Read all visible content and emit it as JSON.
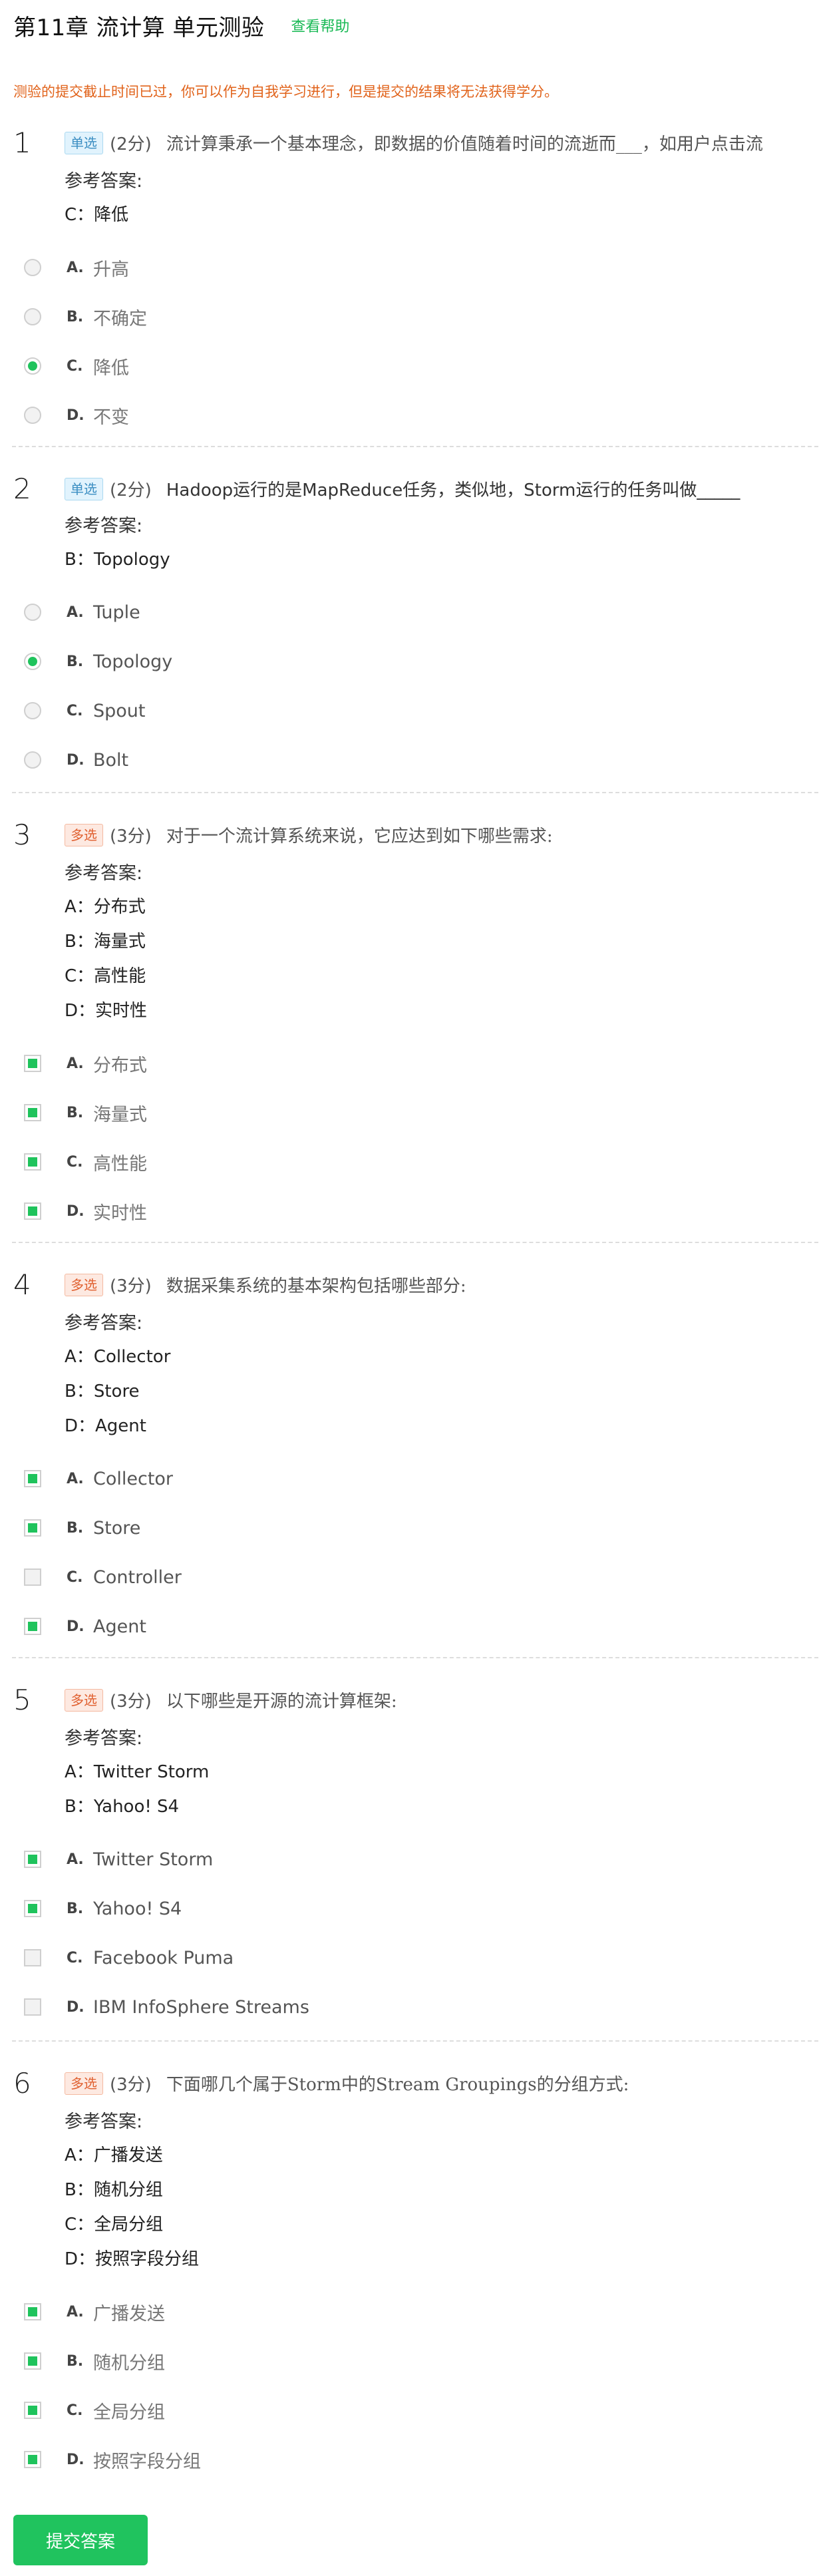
{
  "header": {
    "title": "第11章 流计算 单元测验",
    "help_link": "查看帮助"
  },
  "notice": "测验的提交截止时间已过，你可以作为自我学习进行，但是提交的结果将无法获得学分。",
  "ref_label": "参考答案:",
  "questions": [
    {
      "num": "1",
      "type": "单选",
      "score": "(2分)",
      "text": "流计算秉承一个基本理念，即数据的价值随着时间的流逝而___，如用户点击流",
      "answers": [
        "C：降低"
      ],
      "options": [
        {
          "letter": "A.",
          "text": "升高",
          "checked": false
        },
        {
          "letter": "B.",
          "text": "不确定",
          "checked": false
        },
        {
          "letter": "C.",
          "text": "降低",
          "checked": true
        },
        {
          "letter": "D.",
          "text": "不变",
          "checked": false
        }
      ]
    },
    {
      "num": "2",
      "type": "单选",
      "score": "(2分)",
      "text": "Hadoop运行的是MapReduce任务，类似地，Storm运行的任务叫做_____",
      "answers": [
        "B：Topology"
      ],
      "options": [
        {
          "letter": "A.",
          "text": "Tuple",
          "checked": false
        },
        {
          "letter": "B.",
          "text": "Topology",
          "checked": true
        },
        {
          "letter": "C.",
          "text": "Spout",
          "checked": false
        },
        {
          "letter": "D.",
          "text": "Bolt",
          "checked": false
        }
      ]
    },
    {
      "num": "3",
      "type": "多选",
      "score": "(3分)",
      "text": "对于一个流计算系统来说，它应达到如下哪些需求:",
      "answers": [
        "A：分布式",
        "B：海量式",
        "C：高性能",
        "D：实时性"
      ],
      "options": [
        {
          "letter": "A.",
          "text": "分布式",
          "checked": true
        },
        {
          "letter": "B.",
          "text": "海量式",
          "checked": true
        },
        {
          "letter": "C.",
          "text": "高性能",
          "checked": true
        },
        {
          "letter": "D.",
          "text": "实时性",
          "checked": true
        }
      ]
    },
    {
      "num": "4",
      "type": "多选",
      "score": "(3分)",
      "text": "数据采集系统的基本架构包括哪些部分:",
      "answers": [
        "A：Collector",
        "B：Store",
        "D：Agent"
      ],
      "options": [
        {
          "letter": "A.",
          "text": "Collector",
          "checked": true
        },
        {
          "letter": "B.",
          "text": "Store",
          "checked": true
        },
        {
          "letter": "C.",
          "text": "Controller",
          "checked": false
        },
        {
          "letter": "D.",
          "text": "Agent",
          "checked": true
        }
      ]
    },
    {
      "num": "5",
      "type": "多选",
      "score": "(3分)",
      "text": "以下哪些是开源的流计算框架:",
      "answers": [
        "A：Twitter Storm",
        "B：Yahoo! S4"
      ],
      "options": [
        {
          "letter": "A.",
          "text": "Twitter Storm",
          "checked": true
        },
        {
          "letter": "B.",
          "text": "Yahoo! S4",
          "checked": true
        },
        {
          "letter": "C.",
          "text": "Facebook Puma",
          "checked": false
        },
        {
          "letter": "D.",
          "text": "IBM InfoSphere Streams",
          "checked": false
        }
      ]
    },
    {
      "num": "6",
      "type": "多选",
      "score": "(3分)",
      "text": "下面哪几个属于Storm中的Stream Groupings的分组方式:",
      "answers": [
        "A：广播发送",
        "B：随机分组",
        "C：全局分组",
        "D：按照字段分组"
      ],
      "options": [
        {
          "letter": "A.",
          "text": "广播发送",
          "checked": true
        },
        {
          "letter": "B.",
          "text": "随机分组",
          "checked": true
        },
        {
          "letter": "C.",
          "text": "全局分组",
          "checked": true
        },
        {
          "letter": "D.",
          "text": "按照字段分组",
          "checked": true
        }
      ]
    }
  ],
  "submit_label": "提交答案",
  "colors": {
    "accent_green": "#1fc35c",
    "notice_orange": "#e1631b",
    "single_badge": "#3b8ec2",
    "multi_badge": "#e06030"
  }
}
